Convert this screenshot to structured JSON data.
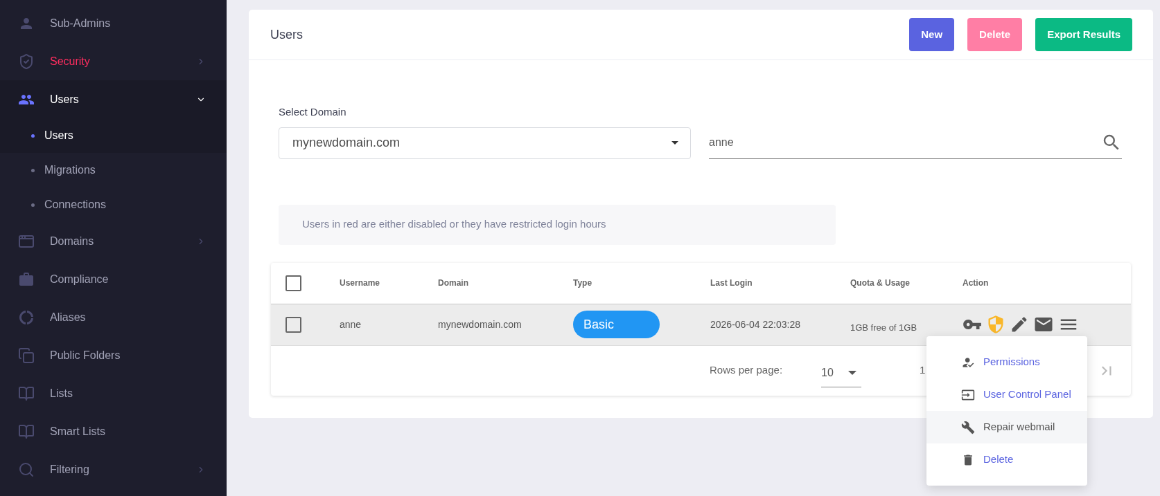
{
  "sidebar": {
    "items": [
      {
        "label": "Sub-Admins",
        "alert": false
      },
      {
        "label": "Security",
        "alert": true,
        "expanded": false
      },
      {
        "label": "Users",
        "alert": false,
        "expanded": true,
        "children": [
          {
            "label": "Users",
            "selected": true
          },
          {
            "label": "Migrations",
            "selected": false
          },
          {
            "label": "Connections",
            "selected": false
          }
        ]
      },
      {
        "label": "Domains",
        "alert": false,
        "expanded": false
      },
      {
        "label": "Compliance",
        "alert": false
      },
      {
        "label": "Aliases",
        "alert": false
      },
      {
        "label": "Public Folders",
        "alert": false
      },
      {
        "label": "Lists",
        "alert": false
      },
      {
        "label": "Smart Lists",
        "alert": false
      },
      {
        "label": "Filtering",
        "alert": false,
        "expanded": false
      }
    ]
  },
  "page": {
    "title": "Users",
    "buttons": [
      {
        "label": "New",
        "kind": "primary"
      },
      {
        "label": "Delete",
        "kind": "danger"
      },
      {
        "label": "Export Results",
        "kind": "success"
      }
    ]
  },
  "domain_select": {
    "label": "Select Domain",
    "value": "mynewdomain.com"
  },
  "search": {
    "value": "anne"
  },
  "notice": "Users in red are either disabled or they have restricted login hours",
  "table": {
    "select_all_checked": false,
    "columns": [
      "Username",
      "Domain",
      "Type",
      "Last Login",
      "Quota & Usage",
      "Action"
    ],
    "rows": [
      {
        "checked": false,
        "username": "anne",
        "domain": "mynewdomain.com",
        "type": "Basic",
        "last_login": "2026-06-04 22:03:28",
        "quota": "1GB free of 1GB"
      }
    ],
    "footer": {
      "rows_per_page_label": "Rows per page:",
      "rows_per_page": "10",
      "page_text": "1"
    }
  },
  "action_menu": {
    "items": [
      {
        "label": "Permissions",
        "highlighted": false
      },
      {
        "label": "User Control Panel",
        "highlighted": false
      },
      {
        "label": "Repair webmail",
        "highlighted": true
      },
      {
        "label": "Delete",
        "highlighted": false
      }
    ]
  }
}
